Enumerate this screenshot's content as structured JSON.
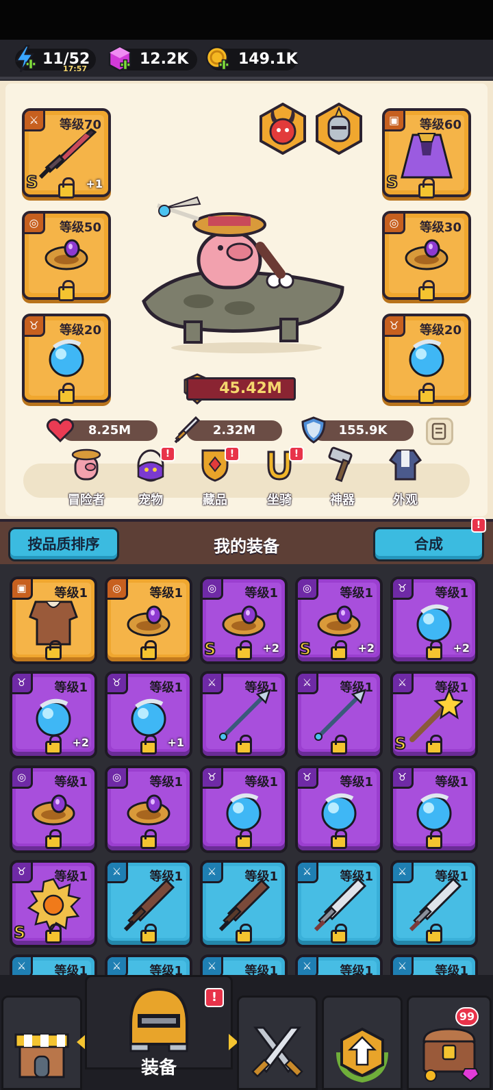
{
  "resources": {
    "energy": {
      "value": "11/52",
      "timer": "17:57"
    },
    "gems": {
      "value": "12.2K"
    },
    "gold": {
      "value": "149.1K"
    }
  },
  "character": {
    "power": "45.42M",
    "stats": {
      "hp": "8.25M",
      "attack": "2.32M",
      "defense": "155.9K"
    },
    "slots": [
      {
        "label": "等级70",
        "rank": "S",
        "plus": "+1"
      },
      {
        "label": "等级60",
        "rank": "S"
      },
      {
        "label": "等级50"
      },
      {
        "label": "等级30"
      },
      {
        "label": "等级20"
      },
      {
        "label": "等级20"
      }
    ]
  },
  "subnav": [
    {
      "label": "冒险者"
    },
    {
      "label": "宠物",
      "badge": "!"
    },
    {
      "label": "藏品",
      "badge": "!"
    },
    {
      "label": "坐骑",
      "badge": "!"
    },
    {
      "label": "神器"
    },
    {
      "label": "外观"
    }
  ],
  "inventory": {
    "sort_label": "按品质排序",
    "title": "我的装备",
    "merge_label": "合成",
    "merge_badge": "!",
    "items": [
      {
        "label": "等级1",
        "rarity": "orange",
        "icon": "armor-icon"
      },
      {
        "label": "等级1",
        "rarity": "orange",
        "icon": "ring-icon"
      },
      {
        "label": "等级1",
        "rarity": "purple",
        "icon": "ring-icon",
        "rank": "S",
        "plus": "+2"
      },
      {
        "label": "等级1",
        "rarity": "purple",
        "icon": "ring-icon",
        "rank": "S",
        "plus": "+2"
      },
      {
        "label": "等级1",
        "rarity": "purple",
        "icon": "orb-icon",
        "plus": "+2"
      },
      {
        "label": "等级1",
        "rarity": "purple",
        "icon": "orb-icon",
        "plus": "+2"
      },
      {
        "label": "等级1",
        "rarity": "purple",
        "icon": "orb-icon",
        "plus": "+1"
      },
      {
        "label": "等级1",
        "rarity": "purple",
        "icon": "spear-icon"
      },
      {
        "label": "等级1",
        "rarity": "purple",
        "icon": "spear-icon"
      },
      {
        "label": "等级1",
        "rarity": "purple",
        "icon": "star-wand-icon",
        "rank": "S"
      },
      {
        "label": "等级1",
        "rarity": "purple",
        "icon": "ring-icon"
      },
      {
        "label": "等级1",
        "rarity": "purple",
        "icon": "ring-icon"
      },
      {
        "label": "等级1",
        "rarity": "purple",
        "icon": "orb-icon"
      },
      {
        "label": "等级1",
        "rarity": "purple",
        "icon": "orb-icon"
      },
      {
        "label": "等级1",
        "rarity": "purple",
        "icon": "orb-icon"
      },
      {
        "label": "等级1",
        "rarity": "purple",
        "icon": "sun-medallion-icon",
        "rank": "S"
      },
      {
        "label": "等级1",
        "rarity": "blue",
        "icon": "wood-sword-icon"
      },
      {
        "label": "等级1",
        "rarity": "blue",
        "icon": "wood-sword-icon"
      },
      {
        "label": "等级1",
        "rarity": "blue",
        "icon": "iron-sword-icon"
      },
      {
        "label": "等级1",
        "rarity": "blue",
        "icon": "iron-sword-icon"
      },
      {
        "label": "等级1",
        "rarity": "blue",
        "icon": "sword-icon"
      },
      {
        "label": "等级1",
        "rarity": "blue",
        "icon": "sword-icon"
      },
      {
        "label": "等级1",
        "rarity": "blue",
        "icon": "sword-icon"
      },
      {
        "label": "等级1",
        "rarity": "blue",
        "icon": "sword-icon"
      },
      {
        "label": "等级1",
        "rarity": "blue",
        "icon": "sword-icon"
      }
    ]
  },
  "bottom_nav": {
    "active_label": "装备",
    "active_badge": "!",
    "chest_count": "99"
  }
}
